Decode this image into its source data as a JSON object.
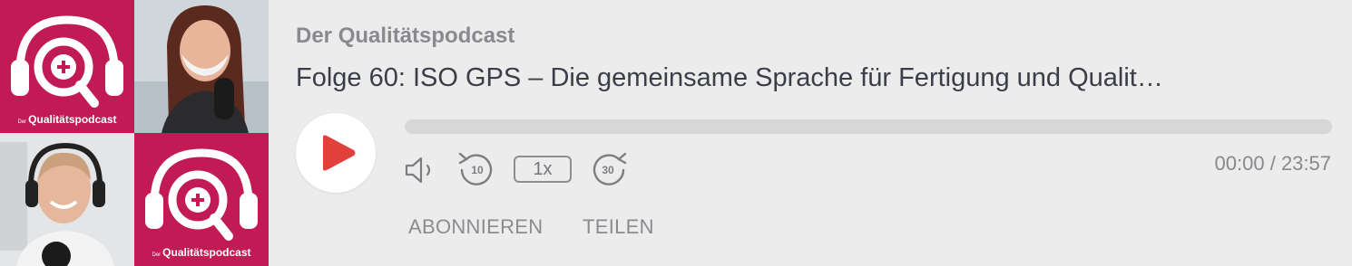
{
  "cover": {
    "logo_caption_prefix": "Der",
    "logo_caption": "Qualitätspodcast"
  },
  "player": {
    "show_title": "Der Qualitätspodcast",
    "episode_title": "Folge 60: ISO GPS – Die gemeinsame Sprache für Fertigung und Qualit…",
    "progress_fraction": 0,
    "skip_back_seconds": "10",
    "skip_forward_seconds": "30",
    "speed": "1x",
    "current_time": "00:00",
    "time_separator": "/",
    "duration": "23:57",
    "subscribe_label": "ABONNIEREN",
    "share_label": "TEILEN"
  },
  "colors": {
    "brand": "#c21a55",
    "play_icon": "#e2403a",
    "background": "#ececec"
  },
  "icons": [
    "play-icon",
    "volume-icon",
    "rewind-10-icon",
    "forward-30-icon",
    "headphones-magnifier-logo"
  ]
}
